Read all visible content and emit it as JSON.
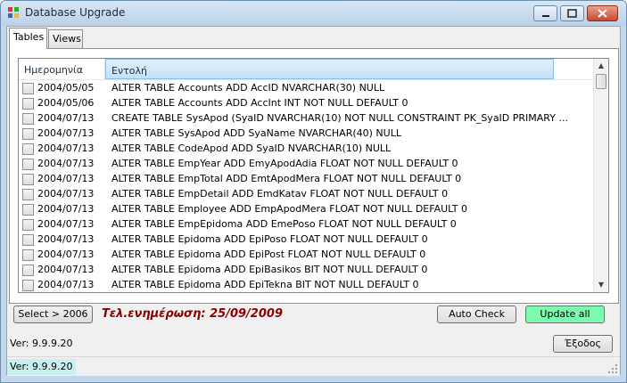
{
  "window": {
    "title": "Database Upgrade",
    "controls": {
      "minimize": "minimize-icon",
      "maximize": "maximize-icon",
      "close": "close-icon"
    }
  },
  "tabs": [
    {
      "label": "Tables",
      "active": true
    },
    {
      "label": "Views",
      "active": false
    }
  ],
  "listview": {
    "columns": [
      "Ημερομηνία",
      "Εντολή"
    ],
    "rows": [
      {
        "date": "2004/05/05",
        "command": "ALTER TABLE Accounts ADD AccID NVARCHAR(30) NULL"
      },
      {
        "date": "2004/05/06",
        "command": "ALTER TABLE Accounts ADD AccInt INT NOT NULL DEFAULT 0"
      },
      {
        "date": "2004/07/13",
        "command": "CREATE TABLE SysApod (SyaID NVARCHAR(10) NOT NULL CONSTRAINT PK_SyaID PRIMARY ..."
      },
      {
        "date": "2004/07/13",
        "command": "ALTER TABLE SysApod ADD SyaName NVARCHAR(40) NULL"
      },
      {
        "date": "2004/07/13",
        "command": "ALTER TABLE CodeApod ADD SyaID NVARCHAR(10) NULL"
      },
      {
        "date": "2004/07/13",
        "command": "ALTER TABLE EmpYear ADD EmyApodAdia FLOAT NOT NULL DEFAULT 0"
      },
      {
        "date": "2004/07/13",
        "command": "ALTER TABLE EmpTotal ADD EmtApodMera FLOAT NOT NULL DEFAULT 0"
      },
      {
        "date": "2004/07/13",
        "command": "ALTER TABLE EmpDetail ADD EmdKatav FLOAT NOT NULL DEFAULT 0"
      },
      {
        "date": "2004/07/13",
        "command": "ALTER TABLE Employee ADD EmpApodMera FLOAT NOT NULL DEFAULT 0"
      },
      {
        "date": "2004/07/13",
        "command": "ALTER TABLE EmpEpidoma ADD EmePoso FLOAT NOT NULL DEFAULT 0"
      },
      {
        "date": "2004/07/13",
        "command": "ALTER TABLE Epidoma ADD EpiPoso FLOAT NOT NULL DEFAULT 0"
      },
      {
        "date": "2004/07/13",
        "command": "ALTER TABLE Epidoma ADD EpiPost FLOAT NOT NULL DEFAULT 0"
      },
      {
        "date": "2004/07/13",
        "command": "ALTER TABLE Epidoma ADD EpiBasikos BIT NOT NULL DEFAULT 0"
      },
      {
        "date": "2004/07/13",
        "command": "ALTER TABLE Epidoma ADD EpiTekna BIT NOT NULL DEFAULT 0"
      }
    ]
  },
  "buttons": {
    "select": "Select > 2006",
    "auto_check": "Auto Check",
    "update_all": "Update all",
    "exit": "Έξοδος"
  },
  "last_update": "Τελ.ενημέρωση: 25/09/2009",
  "version_label": "Ver: 9.9.9.20",
  "status": {
    "version": "Ver: 9.9.9.20"
  },
  "colors": {
    "update_button": "#7dfbae",
    "last_update_text": "#8b0000",
    "status_pane": "#c8f0f0"
  }
}
